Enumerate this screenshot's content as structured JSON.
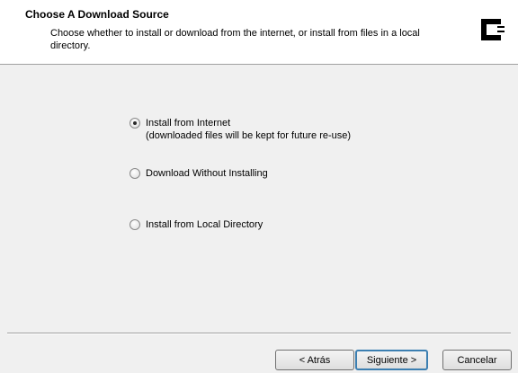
{
  "header": {
    "title": "Choose A Download Source",
    "subtitle": "Choose whether to install or download from the internet, or install from files in a local directory."
  },
  "options": [
    {
      "label": "Install from Internet",
      "note": "(downloaded files will be kept for future re-use)",
      "selected": true
    },
    {
      "label": "Download Without Installing",
      "selected": false
    },
    {
      "label": "Install from Local Directory",
      "selected": false
    }
  ],
  "buttons": {
    "back": "< Atrás",
    "next": "Siguiente >",
    "cancel": "Cancelar"
  },
  "icons": {
    "logo": "cygwin-logo-icon"
  }
}
